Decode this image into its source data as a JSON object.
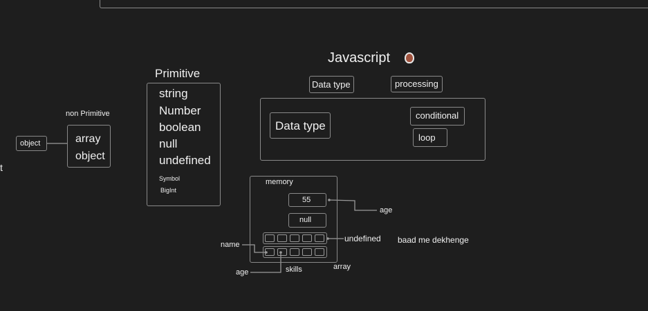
{
  "title": "Javascript",
  "top_boxes": {
    "data_type": "Data type",
    "processing": "processing"
  },
  "main_box": {
    "data_type": "Data type",
    "conditional": "conditional",
    "loop": "loop"
  },
  "primitive": {
    "heading": "Primitive",
    "items": [
      "string",
      "Number",
      "boolean",
      "null",
      "undefined"
    ],
    "small_items": [
      "Symbol",
      "BigInt"
    ]
  },
  "non_primitive": {
    "heading": "non Primitive",
    "items": [
      "array",
      "object"
    ],
    "object_box": "object"
  },
  "edge_fragment": "t",
  "memory": {
    "label": "memory",
    "value_55": "55",
    "value_null": "null",
    "age_label": "age",
    "undefined_label": "undefined",
    "note": "baad me dekhenge",
    "name_label": "name",
    "age_bottom_label": "age",
    "skills_label": "skills",
    "array_label": "array"
  },
  "colors": {
    "background": "#1e1e1e",
    "stroke": "#8a8a8a",
    "text": "#f2f2f2",
    "title_icon": "#a0523d"
  }
}
